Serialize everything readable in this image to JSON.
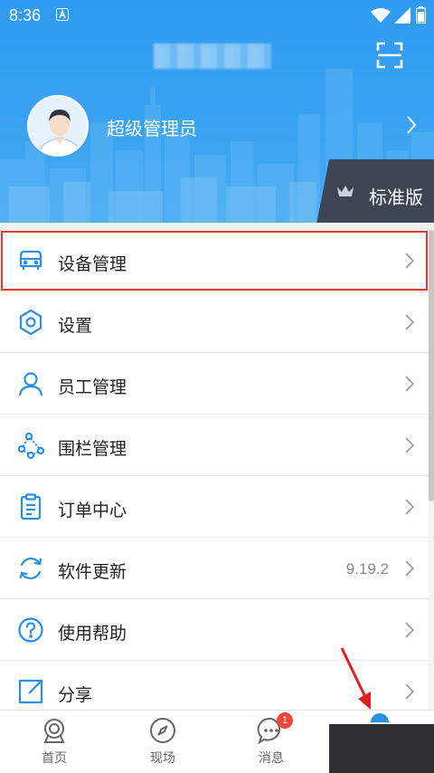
{
  "status_bar": {
    "time": "8:36"
  },
  "header": {
    "username": "超级管理员",
    "edition": "标准版"
  },
  "menu": {
    "items": [
      {
        "label": "设备管理",
        "value": ""
      },
      {
        "label": "设置",
        "value": ""
      },
      {
        "label": "员工管理",
        "value": ""
      },
      {
        "label": "围栏管理",
        "value": ""
      },
      {
        "label": "订单中心",
        "value": ""
      },
      {
        "label": "软件更新",
        "value": "9.19.2"
      },
      {
        "label": "使用帮助",
        "value": ""
      },
      {
        "label": "分享",
        "value": ""
      }
    ]
  },
  "bottom_nav": {
    "items": [
      {
        "label": "首页"
      },
      {
        "label": "现场"
      },
      {
        "label": "消息",
        "badge": "1"
      }
    ]
  },
  "colors": {
    "accent": "#2f9bf0",
    "icon": "#2a8fe6",
    "highlight": "#e53935",
    "badge": "#f2473f"
  }
}
